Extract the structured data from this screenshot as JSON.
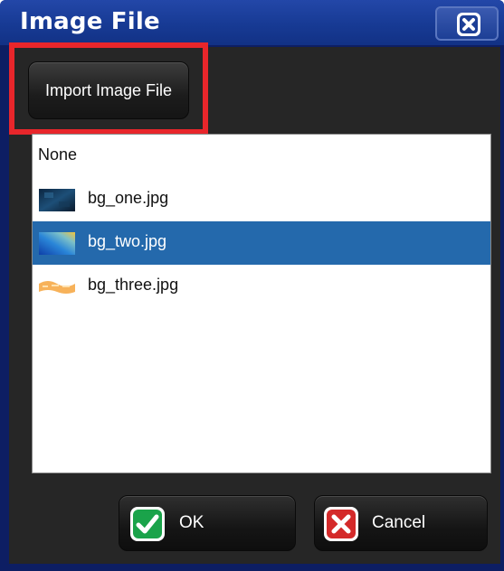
{
  "window": {
    "title": "Image File",
    "close_icon": "close-x-icon"
  },
  "toolbar": {
    "import_label": "Import Image File"
  },
  "list": {
    "items": [
      {
        "label": "None",
        "thumbnail": null,
        "selected": false
      },
      {
        "label": "bg_one.jpg",
        "thumbnail": "dark-blue-image-thumbnail",
        "selected": false
      },
      {
        "label": "bg_two.jpg",
        "thumbnail": "blue-yellow-gradient-thumbnail",
        "selected": true
      },
      {
        "label": "bg_three.jpg",
        "thumbnail": "orange-pattern-thumbnail",
        "selected": false
      }
    ]
  },
  "footer": {
    "ok_label": "OK",
    "ok_icon": "green-check-icon",
    "cancel_label": "Cancel",
    "cancel_icon": "red-x-icon"
  },
  "colors": {
    "title_bar": "#173a94",
    "panel_bg": "#262626",
    "selection": "#2469ac",
    "highlight_border": "#e8262b",
    "ok_green": "#1aa34a",
    "cancel_red": "#d42a2a"
  }
}
